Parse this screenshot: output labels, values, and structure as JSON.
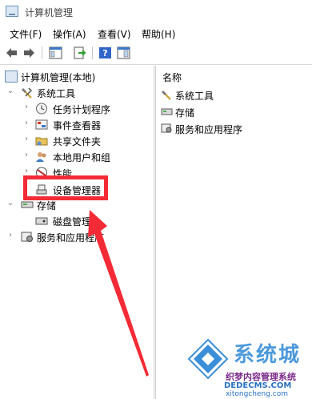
{
  "window": {
    "title": "计算机管理"
  },
  "menu": {
    "items": [
      "文件(F)",
      "操作(A)",
      "查看(V)",
      "帮助(H)"
    ]
  },
  "toolbar": {
    "buttons": [
      "back-icon",
      "forward-icon",
      "show-tree-icon",
      "export-list-icon",
      "help-icon",
      "properties-icon"
    ]
  },
  "tree": {
    "root": "计算机管理(本地)",
    "system_tools": "系统工具",
    "task_scheduler": "任务计划程序",
    "event_viewer": "事件查看器",
    "shared_folders": "共享文件夹",
    "local_users": "本地用户和组",
    "performance": "性能",
    "device_manager": "设备管理器",
    "storage": "存储",
    "disk_management": "磁盘管理",
    "services_apps": "服务和应用程序"
  },
  "list": {
    "column_name": "名称",
    "items": [
      "系统工具",
      "存储",
      "服务和应用程序"
    ]
  },
  "watermark": {
    "brand": "系统城",
    "site_cn": "织梦内容管理系统",
    "url1": "DEDECMS.COM",
    "url2": "xitongcheng.com"
  },
  "colors": {
    "highlight": "#f32b36",
    "selection": "#cce8ff"
  }
}
